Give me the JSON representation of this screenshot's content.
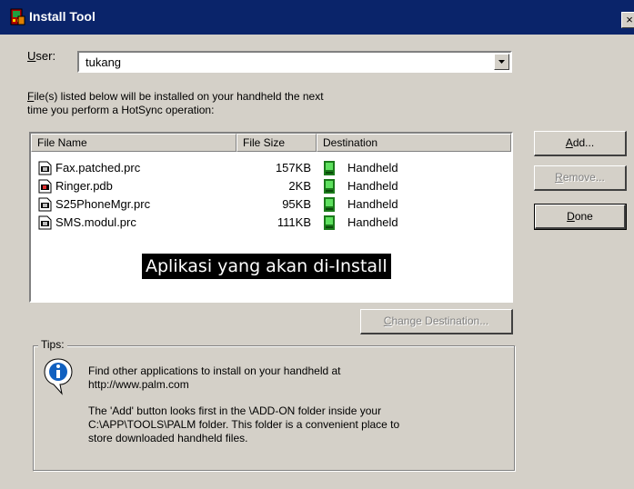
{
  "window": {
    "title": "Install Tool",
    "close": "×"
  },
  "user": {
    "label_ul": "U",
    "label_rest": "ser:",
    "value": "tukang"
  },
  "description": {
    "line1_ul": "F",
    "line1_rest": "ile(s) listed below will be installed on your handheld the next",
    "line2": "time you perform a HotSync operation:"
  },
  "table": {
    "headers": {
      "name": "File Name",
      "size": "File Size",
      "dest": "Destination"
    },
    "rows": [
      {
        "name": "Fax.patched.prc",
        "size": "157KB",
        "dest": "Handheld",
        "icon": "prc-file-icon"
      },
      {
        "name": "Ringer.pdb",
        "size": "2KB",
        "dest": "Handheld",
        "icon": "pdb-file-icon"
      },
      {
        "name": "S25PhoneMgr.prc",
        "size": "95KB",
        "dest": "Handheld",
        "icon": "prc-file-icon"
      },
      {
        "name": "SMS.modul.prc",
        "size": "111KB",
        "dest": "Handheld",
        "icon": "prc-file-icon"
      }
    ]
  },
  "overlay_caption": "Aplikasi yang akan di-Install",
  "buttons": {
    "add": {
      "ul": "A",
      "rest": "dd..."
    },
    "remove": {
      "ul": "R",
      "rest": "emove..."
    },
    "done": {
      "ul": "D",
      "rest": "one"
    },
    "change_destination": {
      "ul": "C",
      "rest": "hange Destination..."
    }
  },
  "tips": {
    "label": "Tips:",
    "para1_line1": "Find other applications to install on your handheld at",
    "para1_line2": "http://www.palm.com",
    "para2_line1": "The 'Add' button looks first in the \\ADD-ON folder inside your",
    "para2_line2": "C:\\APP\\TOOLS\\PALM folder. This folder is a convenient place to",
    "para2_line3": "store downloaded handheld files."
  },
  "colors": {
    "title_bar": "#0a246a",
    "face": "#d4d0c8",
    "caption_bg": "#000000",
    "caption_fg": "#ffffff"
  }
}
